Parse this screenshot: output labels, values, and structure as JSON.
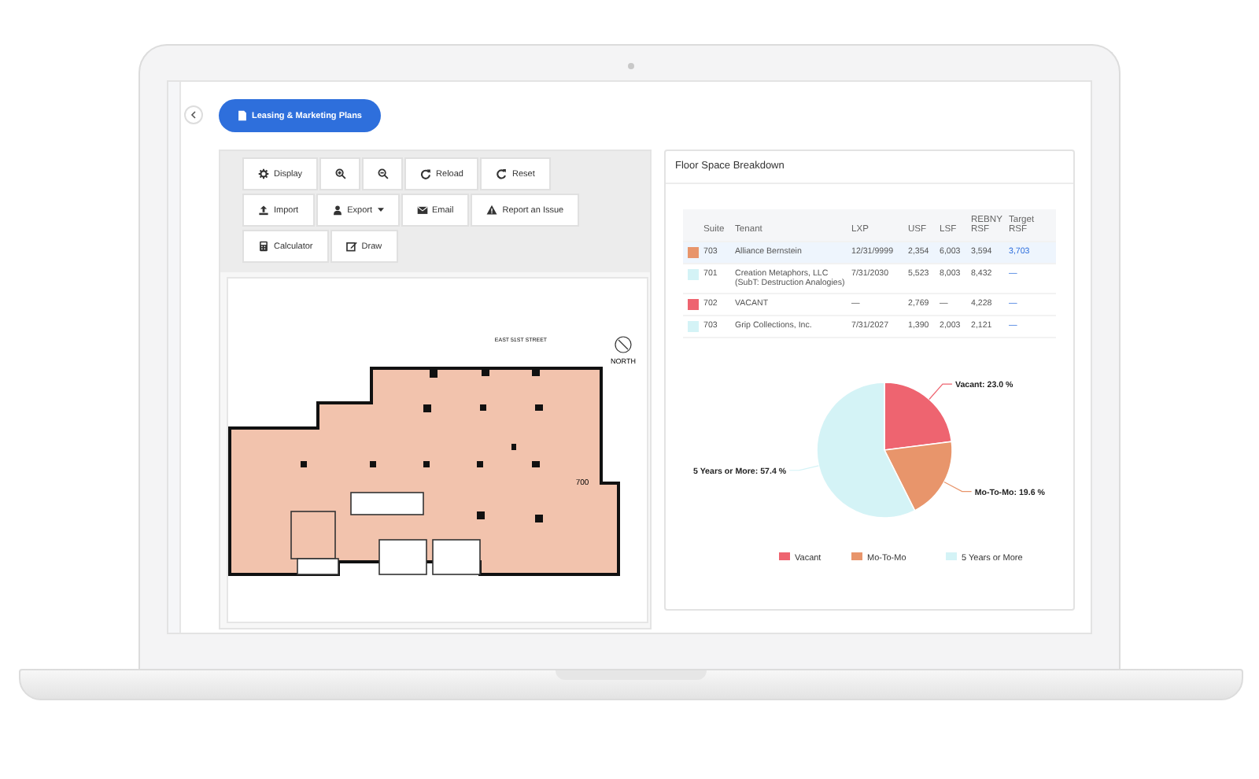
{
  "header_button": {
    "label": "Leasing & Marketing Plans"
  },
  "toolbar": {
    "rows": [
      {
        "buttons": [
          {
            "kind": "text",
            "label": "Display"
          },
          {
            "kind": "icon"
          },
          {
            "kind": "icon"
          },
          {
            "kind": "text",
            "label": "Reload"
          },
          {
            "kind": "text",
            "label": "Reset"
          }
        ]
      },
      {
        "buttons": [
          {
            "kind": "text",
            "label": "Import"
          },
          {
            "kind": "dropdown",
            "label": "Export"
          },
          {
            "kind": "text",
            "label": "Email"
          },
          {
            "kind": "text",
            "label": "Report an Issue"
          }
        ]
      },
      {
        "buttons": [
          {
            "kind": "text",
            "label": "Calculator"
          },
          {
            "kind": "text",
            "label": "Draw"
          }
        ]
      }
    ]
  },
  "floor_plan": {
    "street_label": "EAST 51ST STREET",
    "compass_label": "NORTH",
    "suite_label": "700"
  },
  "breakdown": {
    "title": "Floor Space Breakdown",
    "table": {
      "columns": [
        "Suite",
        "Tenant",
        "LXP",
        "USF",
        "LSF",
        "REBNY RSF",
        "Target RSF"
      ],
      "rows": [
        {
          "color": "#e8956b",
          "selected": true,
          "cells": [
            "703",
            "Alliance Bernstein",
            "12/31/9999",
            "2,354",
            "6,003",
            "3,594",
            "3,703"
          ]
        },
        {
          "color": "#d4f3f6",
          "selected": false,
          "cells": [
            "701",
            "Creation Metaphors, LLC (SubT: Destruction Analogies)",
            "7/31/2030",
            "5,523",
            "8,003",
            "8,432",
            "—"
          ]
        },
        {
          "color": "#ee6470",
          "selected": false,
          "cells": [
            "702",
            "VACANT",
            "—",
            "2,769",
            "—",
            "4,228",
            "—"
          ]
        },
        {
          "color": "#d4f3f6",
          "selected": false,
          "cells": [
            "703",
            "Grip Collections, Inc.",
            "7/31/2027",
            "1,390",
            "2,003",
            "2,121",
            "—"
          ]
        }
      ]
    },
    "chart_data": {
      "type": "pie",
      "categories": [
        "Vacant",
        "Mo-To-Mo",
        "5 Years or More"
      ],
      "values": [
        23.0,
        19.6,
        57.4
      ],
      "legend": true,
      "colors": [
        "#ee6470",
        "#e8956b",
        "#d4f3f6"
      ],
      "value_labels": [
        "Vacant: 23.0 %",
        "Mo-To-Mo: 19.6 %",
        "5 Years or More: 57.4 %"
      ]
    }
  }
}
